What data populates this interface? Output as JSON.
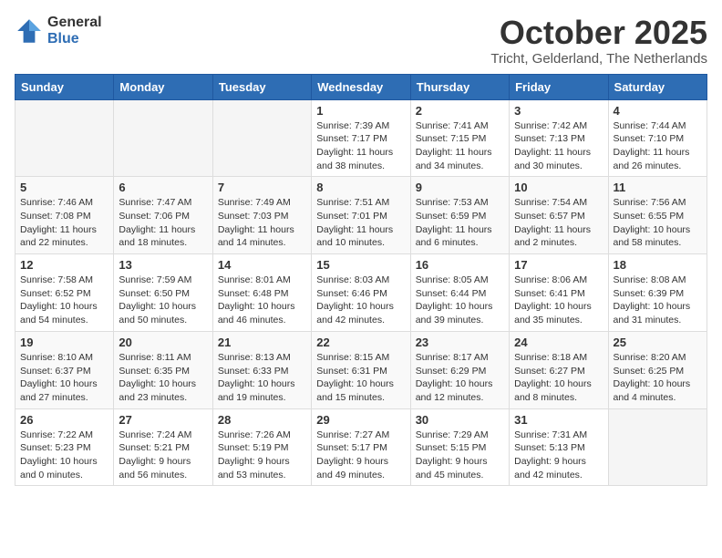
{
  "logo": {
    "general": "General",
    "blue": "Blue"
  },
  "header": {
    "month": "October 2025",
    "location": "Tricht, Gelderland, The Netherlands"
  },
  "weekdays": [
    "Sunday",
    "Monday",
    "Tuesday",
    "Wednesday",
    "Thursday",
    "Friday",
    "Saturday"
  ],
  "weeks": [
    [
      {
        "day": "",
        "info": ""
      },
      {
        "day": "",
        "info": ""
      },
      {
        "day": "",
        "info": ""
      },
      {
        "day": "1",
        "info": "Sunrise: 7:39 AM\nSunset: 7:17 PM\nDaylight: 11 hours\nand 38 minutes."
      },
      {
        "day": "2",
        "info": "Sunrise: 7:41 AM\nSunset: 7:15 PM\nDaylight: 11 hours\nand 34 minutes."
      },
      {
        "day": "3",
        "info": "Sunrise: 7:42 AM\nSunset: 7:13 PM\nDaylight: 11 hours\nand 30 minutes."
      },
      {
        "day": "4",
        "info": "Sunrise: 7:44 AM\nSunset: 7:10 PM\nDaylight: 11 hours\nand 26 minutes."
      }
    ],
    [
      {
        "day": "5",
        "info": "Sunrise: 7:46 AM\nSunset: 7:08 PM\nDaylight: 11 hours\nand 22 minutes."
      },
      {
        "day": "6",
        "info": "Sunrise: 7:47 AM\nSunset: 7:06 PM\nDaylight: 11 hours\nand 18 minutes."
      },
      {
        "day": "7",
        "info": "Sunrise: 7:49 AM\nSunset: 7:03 PM\nDaylight: 11 hours\nand 14 minutes."
      },
      {
        "day": "8",
        "info": "Sunrise: 7:51 AM\nSunset: 7:01 PM\nDaylight: 11 hours\nand 10 minutes."
      },
      {
        "day": "9",
        "info": "Sunrise: 7:53 AM\nSunset: 6:59 PM\nDaylight: 11 hours\nand 6 minutes."
      },
      {
        "day": "10",
        "info": "Sunrise: 7:54 AM\nSunset: 6:57 PM\nDaylight: 11 hours\nand 2 minutes."
      },
      {
        "day": "11",
        "info": "Sunrise: 7:56 AM\nSunset: 6:55 PM\nDaylight: 10 hours\nand 58 minutes."
      }
    ],
    [
      {
        "day": "12",
        "info": "Sunrise: 7:58 AM\nSunset: 6:52 PM\nDaylight: 10 hours\nand 54 minutes."
      },
      {
        "day": "13",
        "info": "Sunrise: 7:59 AM\nSunset: 6:50 PM\nDaylight: 10 hours\nand 50 minutes."
      },
      {
        "day": "14",
        "info": "Sunrise: 8:01 AM\nSunset: 6:48 PM\nDaylight: 10 hours\nand 46 minutes."
      },
      {
        "day": "15",
        "info": "Sunrise: 8:03 AM\nSunset: 6:46 PM\nDaylight: 10 hours\nand 42 minutes."
      },
      {
        "day": "16",
        "info": "Sunrise: 8:05 AM\nSunset: 6:44 PM\nDaylight: 10 hours\nand 39 minutes."
      },
      {
        "day": "17",
        "info": "Sunrise: 8:06 AM\nSunset: 6:41 PM\nDaylight: 10 hours\nand 35 minutes."
      },
      {
        "day": "18",
        "info": "Sunrise: 8:08 AM\nSunset: 6:39 PM\nDaylight: 10 hours\nand 31 minutes."
      }
    ],
    [
      {
        "day": "19",
        "info": "Sunrise: 8:10 AM\nSunset: 6:37 PM\nDaylight: 10 hours\nand 27 minutes."
      },
      {
        "day": "20",
        "info": "Sunrise: 8:11 AM\nSunset: 6:35 PM\nDaylight: 10 hours\nand 23 minutes."
      },
      {
        "day": "21",
        "info": "Sunrise: 8:13 AM\nSunset: 6:33 PM\nDaylight: 10 hours\nand 19 minutes."
      },
      {
        "day": "22",
        "info": "Sunrise: 8:15 AM\nSunset: 6:31 PM\nDaylight: 10 hours\nand 15 minutes."
      },
      {
        "day": "23",
        "info": "Sunrise: 8:17 AM\nSunset: 6:29 PM\nDaylight: 10 hours\nand 12 minutes."
      },
      {
        "day": "24",
        "info": "Sunrise: 8:18 AM\nSunset: 6:27 PM\nDaylight: 10 hours\nand 8 minutes."
      },
      {
        "day": "25",
        "info": "Sunrise: 8:20 AM\nSunset: 6:25 PM\nDaylight: 10 hours\nand 4 minutes."
      }
    ],
    [
      {
        "day": "26",
        "info": "Sunrise: 7:22 AM\nSunset: 5:23 PM\nDaylight: 10 hours\nand 0 minutes."
      },
      {
        "day": "27",
        "info": "Sunrise: 7:24 AM\nSunset: 5:21 PM\nDaylight: 9 hours\nand 56 minutes."
      },
      {
        "day": "28",
        "info": "Sunrise: 7:26 AM\nSunset: 5:19 PM\nDaylight: 9 hours\nand 53 minutes."
      },
      {
        "day": "29",
        "info": "Sunrise: 7:27 AM\nSunset: 5:17 PM\nDaylight: 9 hours\nand 49 minutes."
      },
      {
        "day": "30",
        "info": "Sunrise: 7:29 AM\nSunset: 5:15 PM\nDaylight: 9 hours\nand 45 minutes."
      },
      {
        "day": "31",
        "info": "Sunrise: 7:31 AM\nSunset: 5:13 PM\nDaylight: 9 hours\nand 42 minutes."
      },
      {
        "day": "",
        "info": ""
      }
    ]
  ]
}
